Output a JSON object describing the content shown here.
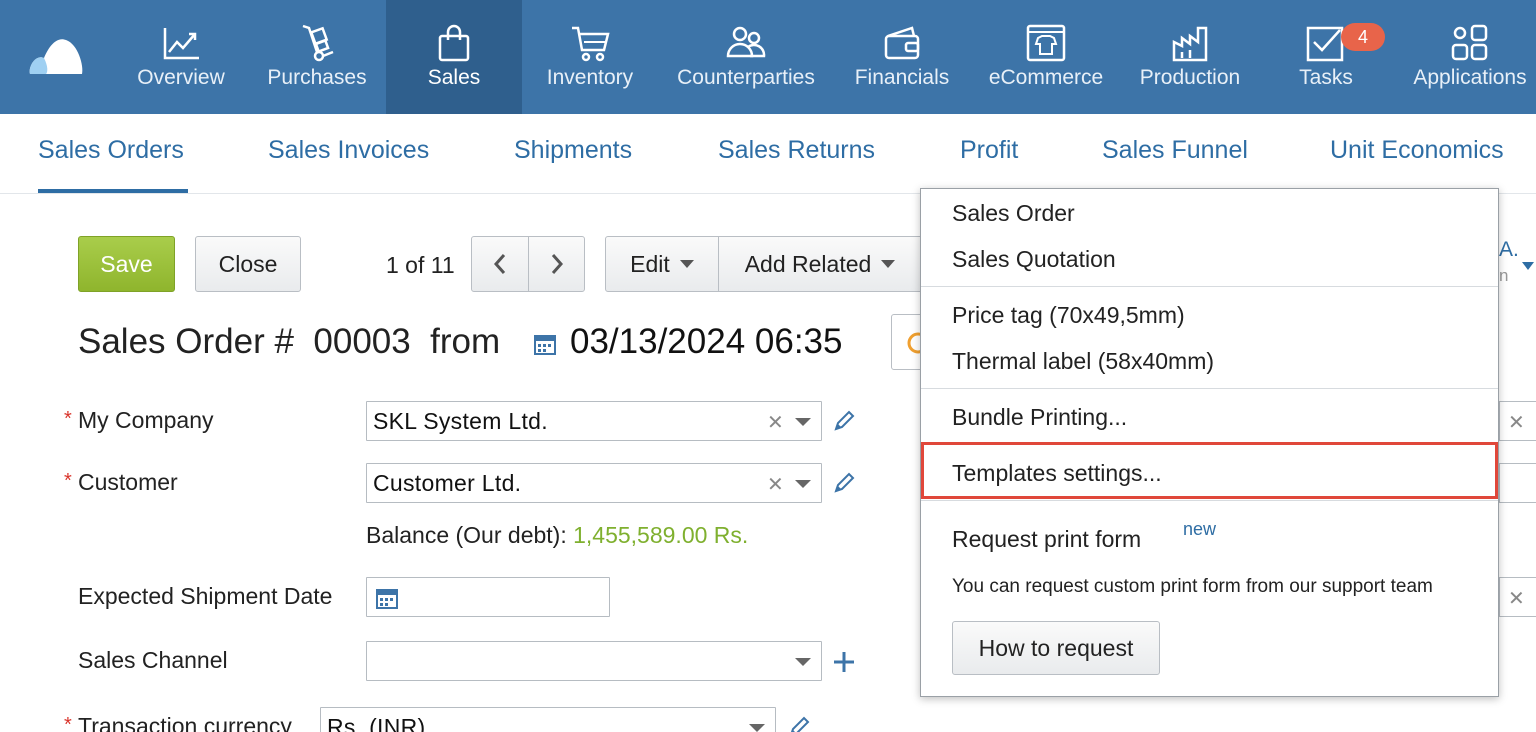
{
  "topnav": {
    "items": [
      {
        "label": "Overview",
        "icon": "chart-line-icon"
      },
      {
        "label": "Purchases",
        "icon": "hand-truck-icon"
      },
      {
        "label": "Sales",
        "icon": "shopping-bag-icon",
        "active": true
      },
      {
        "label": "Inventory",
        "icon": "cart-icon"
      },
      {
        "label": "Counterparties",
        "icon": "people-icon"
      },
      {
        "label": "Financials",
        "icon": "wallet-icon"
      },
      {
        "label": "eCommerce",
        "icon": "storefront-icon"
      },
      {
        "label": "Production",
        "icon": "factory-icon"
      },
      {
        "label": "Tasks",
        "icon": "checkbox-icon"
      },
      {
        "label": "Applications",
        "icon": "apps-grid-icon"
      }
    ],
    "tasks_badge": "4",
    "accent_color": "#3d74a8",
    "active_color": "#2f5f8d"
  },
  "subtabs": {
    "items": [
      "Sales Orders",
      "Sales Invoices",
      "Shipments",
      "Sales Returns",
      "Profit",
      "Sales Funnel",
      "Unit Economics"
    ],
    "active": "Sales Orders"
  },
  "toolbar": {
    "save_label": "Save",
    "close_label": "Close",
    "pager_text": "1 of 11",
    "edit_label": "Edit",
    "add_related_label": "Add Related"
  },
  "document": {
    "title_prefix": "Sales Order #",
    "number": "00003",
    "from_label": "from",
    "datetime": "03/13/2024 06:35"
  },
  "form": {
    "my_company_label": "My Company",
    "my_company_value": "SKL System Ltd.",
    "customer_label": "Customer",
    "customer_value": "Customer Ltd.",
    "balance_label": "Balance (Our debt):",
    "balance_value": "1,455,589.00 Rs.",
    "expected_shipment_label": "Expected Shipment Date",
    "expected_shipment_value": "",
    "sales_channel_label": "Sales Channel",
    "sales_channel_value": "",
    "currency_label": "Transaction currency",
    "currency_value": "Rs. (INR)"
  },
  "print_menu": {
    "items_group1": [
      "Sales Order",
      "Sales Quotation"
    ],
    "items_group2": [
      "Price tag (70x49,5mm)",
      "Thermal label (58x40mm)"
    ],
    "bundle_printing": "Bundle Printing...",
    "templates_settings": "Templates settings...",
    "request_print_form": "Request print form",
    "new_badge": "new",
    "note": "You can request custom print form from our support team",
    "how_to_request": "How to request",
    "highlight_color": "#e0473a"
  },
  "edge_fragments": {
    "top_text": "A.",
    "sub_text": "n"
  }
}
